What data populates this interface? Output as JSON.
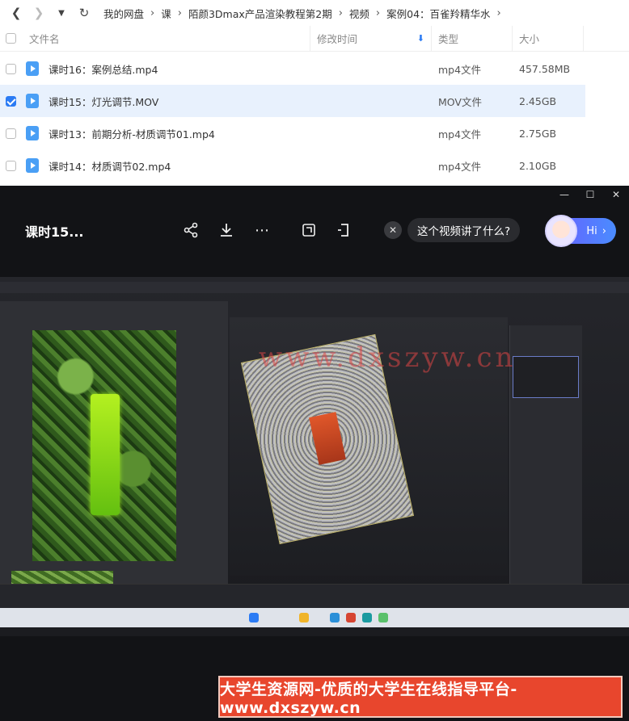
{
  "breadcrumb": [
    "我的网盘",
    "课",
    "陌颜3Dmax产品渲染教程第2期",
    "视频",
    "案例04：百雀羚精华水"
  ],
  "columns": {
    "name": "文件名",
    "time": "修改时间",
    "type": "类型",
    "size": "大小"
  },
  "files": [
    {
      "name": "课时16：案例总结.mp4",
      "type": "mp4文件",
      "size": "457.58MB",
      "checked": false
    },
    {
      "name": "课时15：灯光调节.MOV",
      "type": "MOV文件",
      "size": "2.45GB",
      "checked": true
    },
    {
      "name": "课时13：前期分析-材质调节01.mp4",
      "type": "mp4文件",
      "size": "2.75GB",
      "checked": false
    },
    {
      "name": "课时14：材质调节02.mp4",
      "type": "mp4文件",
      "size": "2.10GB",
      "checked": false
    }
  ],
  "player": {
    "title": "课时15...",
    "ask_prompt": "这个视频讲了什么?",
    "hi_label": "Hi"
  },
  "watermark_top": "www.dxszyw.cn",
  "banner_text": "大学生资源网-优质的大学生在线指导平台-www.dxszyw.cn",
  "colors": {
    "accent": "#2b7bf4",
    "selected_row": "#e8f1fd",
    "banner": "#e8462d"
  }
}
